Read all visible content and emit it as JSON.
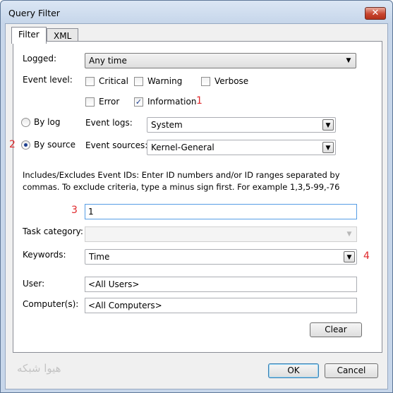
{
  "window": {
    "title": "Query Filter",
    "close_glyph": "✕"
  },
  "tabs": [
    {
      "label": "Filter",
      "active": true
    },
    {
      "label": "XML",
      "active": false
    }
  ],
  "filter": {
    "logged": {
      "label": "Logged:",
      "value": "Any time"
    },
    "event_level": {
      "label": "Event level:",
      "levels": [
        {
          "label": "Critical",
          "checked": false
        },
        {
          "label": "Warning",
          "checked": false
        },
        {
          "label": "Verbose",
          "checked": false
        },
        {
          "label": "Error",
          "checked": false
        },
        {
          "label": "Information",
          "checked": true
        }
      ]
    },
    "by_log": {
      "label": "By log",
      "selected": false,
      "field_label": "Event logs:",
      "value": "System"
    },
    "by_source": {
      "label": "By source",
      "selected": true,
      "field_label": "Event sources:",
      "value": "Kernel-General"
    },
    "event_ids": {
      "help_text": "Includes/Excludes Event IDs: Enter ID numbers and/or ID ranges separated by commas. To exclude criteria, type a minus sign first. For example 1,3,5-99,-76",
      "value": "1"
    },
    "task_category": {
      "label": "Task category:",
      "value": ""
    },
    "keywords": {
      "label": "Keywords:",
      "value": "Time"
    },
    "user": {
      "label": "User:",
      "value": "<All Users>"
    },
    "computer": {
      "label": "Computer(s):",
      "value": "<All Computers>"
    },
    "clear_label": "Clear"
  },
  "annotations": {
    "n1": "1",
    "n2": "2",
    "n3": "3",
    "n4": "4"
  },
  "footer": {
    "watermark": "هیوا شبکه",
    "ok_label": "OK",
    "cancel_label": "Cancel"
  },
  "icons": {
    "checkmark": "✓",
    "dropdown": "▼"
  },
  "colors": {
    "annotation": "#e0282b",
    "focus_border": "#569de5"
  }
}
